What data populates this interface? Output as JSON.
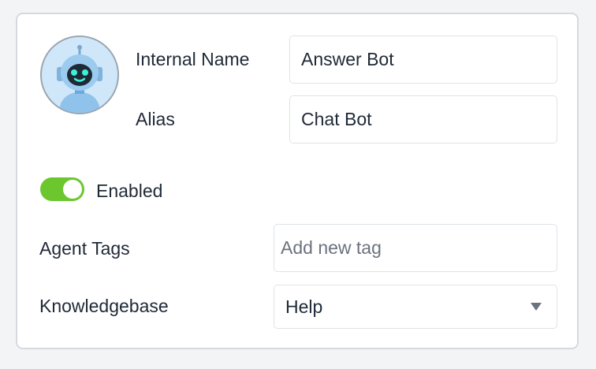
{
  "profile": {
    "avatar_icon": "robot-avatar-icon",
    "internal_name_label": "Internal Name",
    "internal_name_value": "Answer Bot",
    "alias_label": "Alias",
    "alias_value": "Chat Bot"
  },
  "status": {
    "enabled_label": "Enabled",
    "enabled": true,
    "toggle_color": "#6cc72f"
  },
  "agent_tags": {
    "label": "Agent Tags",
    "placeholder": "Add new tag"
  },
  "knowledgebase": {
    "label": "Knowledgebase",
    "selected": "Help"
  }
}
